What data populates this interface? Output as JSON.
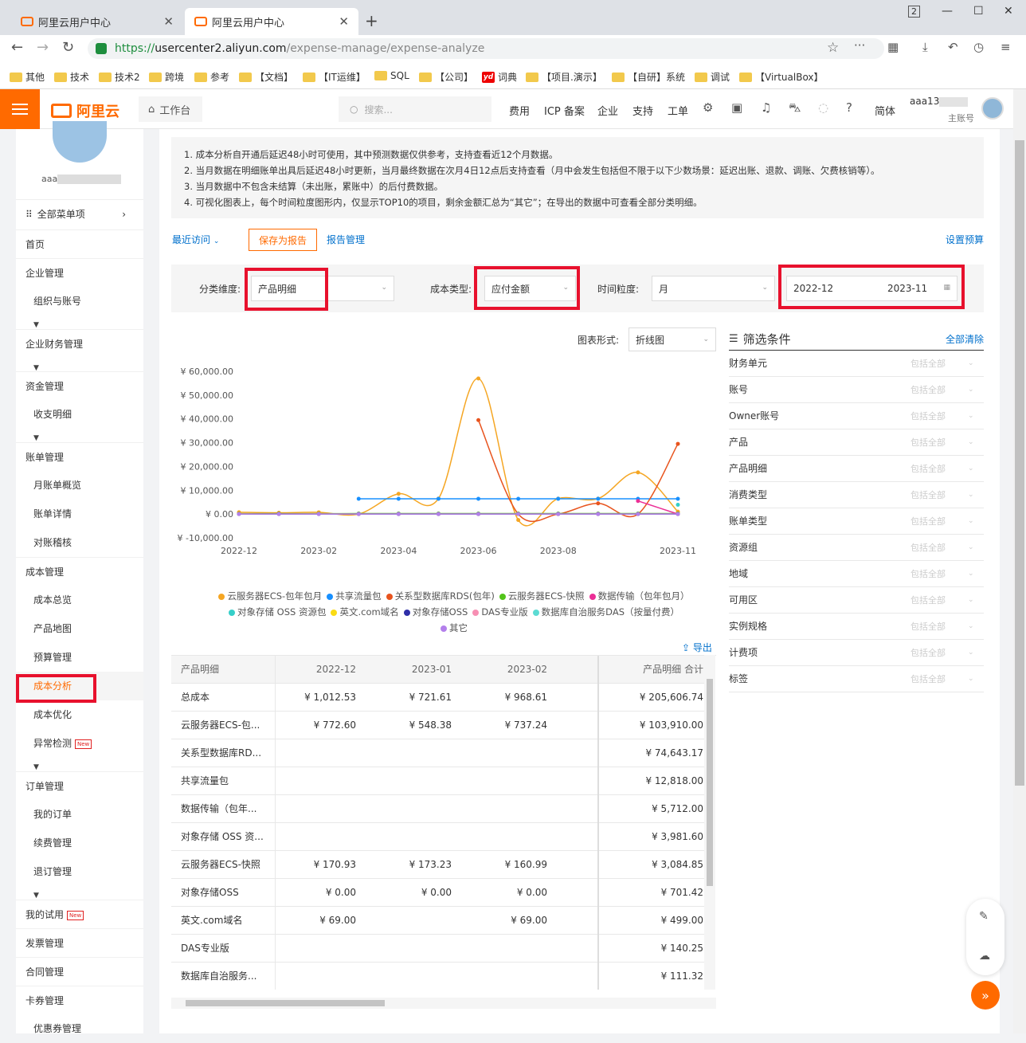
{
  "browser": {
    "tabs": [
      {
        "label": "阿里云用户中心"
      },
      {
        "label": "阿里云用户中心"
      }
    ],
    "tab_count_badge": "2",
    "url": {
      "scheme": "https://",
      "host": "usercenter2.aliyun.com",
      "path": "/expense-manage/expense-analyze"
    },
    "bookmarks": [
      "其他",
      "技术",
      "技术2",
      "跨境",
      "参考",
      "【文档】",
      "【IT运维】",
      "SQL",
      "【公司】",
      "词典",
      "【项目.演示】",
      "【自研】系统",
      "调试",
      "【VirtualBox】"
    ],
    "youdao_label": "yd"
  },
  "header": {
    "logo_text": "阿里云",
    "workbench": "工作台",
    "search_placeholder": "搜索...",
    "nav": [
      "费用",
      "ICP 备案",
      "企业",
      "支持",
      "工单"
    ],
    "lang": "简体",
    "user": "aaa13",
    "user_role": "主账号"
  },
  "sidebar": {
    "username": "aaa",
    "all_menu": "全部菜单项",
    "items": [
      {
        "label": "首页",
        "type": "top"
      },
      {
        "label": "企业管理",
        "type": "top"
      },
      {
        "label": "组织与账号",
        "type": "sub",
        "caret": true
      },
      {
        "label": "企业财务管理",
        "type": "top",
        "caret": true
      },
      {
        "label": "资金管理",
        "type": "top"
      },
      {
        "label": "收支明细",
        "type": "sub",
        "caret": true
      },
      {
        "label": "账单管理",
        "type": "top"
      },
      {
        "label": "月账单概览",
        "type": "sub"
      },
      {
        "label": "账单详情",
        "type": "sub"
      },
      {
        "label": "对账稽核",
        "type": "sub"
      },
      {
        "label": "成本管理",
        "type": "top"
      },
      {
        "label": "成本总览",
        "type": "sub"
      },
      {
        "label": "产品地图",
        "type": "sub"
      },
      {
        "label": "预算管理",
        "type": "sub"
      },
      {
        "label": "成本分析",
        "type": "sub",
        "active": true
      },
      {
        "label": "成本优化",
        "type": "sub"
      },
      {
        "label": "异常检测",
        "type": "sub",
        "badge": "New",
        "caret": true
      },
      {
        "label": "订单管理",
        "type": "top"
      },
      {
        "label": "我的订单",
        "type": "sub"
      },
      {
        "label": "续费管理",
        "type": "sub"
      },
      {
        "label": "退订管理",
        "type": "sub",
        "caret": true
      },
      {
        "label": "我的试用",
        "type": "top",
        "badge": "New"
      },
      {
        "label": "发票管理",
        "type": "top"
      },
      {
        "label": "合同管理",
        "type": "top"
      },
      {
        "label": "卡券管理",
        "type": "top"
      },
      {
        "label": "优惠券管理",
        "type": "sub"
      }
    ]
  },
  "notes": [
    "1. 成本分析自开通后延迟48小时可使用，其中预测数据仅供参考，支持查看近12个月数据。",
    "2. 当月数据在明细账单出具后延迟48小时更新，当月最终数据在次月4日12点后支持查看（月中会发生包括但不限于以下少数场景：延迟出账、退款、调账、欠费核销等）。",
    "3. 当月数据中不包含未结算（未出账，累账中）的后付费数据。",
    "4. 可视化图表上，每个时间粒度图形内，仅显示TOP10的项目，剩余金额汇总为“其它”；在导出的数据中可查看全部分类明细。"
  ],
  "toolbar": {
    "recent": "最近访问",
    "save": "保存为报告",
    "reports": "报告管理",
    "budget": "设置预算"
  },
  "filters_bar": {
    "dimension_label": "分类维度:",
    "dimension_value": "产品明细",
    "cost_type_label": "成本类型:",
    "cost_type_value": "应付金额",
    "granularity_label": "时间粒度:",
    "granularity_value": "月",
    "date_start": "2022-12",
    "date_end": "2023-11"
  },
  "chart_form": {
    "label": "图表形式:",
    "value": "折线图"
  },
  "chart_data": {
    "type": "line",
    "x": [
      "2022-12",
      "2023-01",
      "2023-02",
      "2023-03",
      "2023-04",
      "2023-05",
      "2023-06",
      "2023-07",
      "2023-08",
      "2023-09",
      "2023-10",
      "2023-11"
    ],
    "x_tick_labels": [
      "2022-12",
      "2023-02",
      "2023-04",
      "2023-06",
      "2023-08",
      "2023-11"
    ],
    "y_tick_labels": [
      "¥ 60,000.00",
      "¥ 50,000.00",
      "¥ 40,000.00",
      "¥ 30,000.00",
      "¥ 20,000.00",
      "¥ 10,000.00",
      "¥ 0.00",
      "¥ -10,000.00"
    ],
    "ylim": [
      -10000,
      60000
    ],
    "series": [
      {
        "name": "云服务器ECS-包年包月",
        "color": "#f5a623",
        "values": [
          772.6,
          548.38,
          737.24,
          0,
          8500,
          6500,
          57000,
          -2500,
          6500,
          6500,
          17500,
          1000
        ]
      },
      {
        "name": "共享流量包",
        "color": "#1890ff",
        "values": [
          null,
          null,
          null,
          6400,
          6400,
          6400,
          6400,
          6400,
          6400,
          6400,
          6400,
          6400
        ]
      },
      {
        "name": "关系型数据库RDS(包年)",
        "color": "#e8541e",
        "values": [
          null,
          null,
          null,
          null,
          null,
          null,
          39500,
          0,
          0,
          4500,
          0,
          29500
        ]
      },
      {
        "name": "云服务器ECS-快照",
        "color": "#52c41a",
        "values": [
          170.93,
          173.23,
          160.99,
          200,
          200,
          200,
          200,
          200,
          200,
          200,
          200,
          200
        ]
      },
      {
        "name": "数据传输（包年包月）",
        "color": "#eb2f96",
        "values": [
          null,
          null,
          null,
          null,
          null,
          null,
          null,
          null,
          null,
          null,
          5500,
          0
        ]
      },
      {
        "name": "对象存储 OSS 资源包",
        "color": "#36cfc9",
        "values": [
          null,
          null,
          null,
          null,
          null,
          null,
          null,
          null,
          null,
          null,
          null,
          3900
        ]
      },
      {
        "name": "英文.com域名",
        "color": "#fadb14",
        "values": [
          69,
          0,
          69,
          0,
          0,
          0,
          0,
          0,
          0,
          0,
          0,
          0
        ]
      },
      {
        "name": "对象存储OSS",
        "color": "#2f2fa8",
        "values": [
          0,
          0,
          0,
          0,
          0,
          0,
          0,
          0,
          0,
          0,
          0,
          0
        ]
      },
      {
        "name": "DAS专业版",
        "color": "#f78fb3",
        "values": [
          null,
          null,
          null,
          null,
          null,
          null,
          null,
          null,
          null,
          null,
          null,
          null
        ]
      },
      {
        "name": "数据库自治服务DAS（按量付费）",
        "color": "#5cdbd3",
        "values": [
          null,
          null,
          null,
          null,
          null,
          null,
          null,
          null,
          null,
          null,
          null,
          null
        ]
      },
      {
        "name": "其它",
        "color": "#b37feb",
        "values": [
          0,
          0,
          0,
          0,
          0,
          0,
          0,
          0,
          0,
          0,
          0,
          0
        ]
      }
    ]
  },
  "export": "导出",
  "filter_panel": {
    "title": "筛选条件",
    "clear": "全部清除",
    "include_all": "包括全部",
    "rows": [
      "财务单元",
      "账号",
      "Owner账号",
      "产品",
      "产品明细",
      "消费类型",
      "账单类型",
      "资源组",
      "地域",
      "可用区",
      "实例规格",
      "计费项",
      "标签"
    ]
  },
  "table": {
    "headers": [
      "产品明细",
      "2022-12",
      "2023-01",
      "2023-02",
      "产品明细 合计"
    ],
    "rows": [
      [
        "总成本",
        "¥ 1,012.53",
        "¥ 721.61",
        "¥ 968.61",
        "¥ 205,606.74"
      ],
      [
        "云服务器ECS-包...",
        "¥ 772.60",
        "¥ 548.38",
        "¥ 737.24",
        "¥ 103,910.00"
      ],
      [
        "关系型数据库RD...",
        "",
        "",
        "",
        "¥ 74,643.17"
      ],
      [
        "共享流量包",
        "",
        "",
        "",
        "¥ 12,818.00"
      ],
      [
        "数据传输（包年...",
        "",
        "",
        "",
        "¥ 5,712.00"
      ],
      [
        "对象存储 OSS 资...",
        "",
        "",
        "",
        "¥ 3,981.60"
      ],
      [
        "云服务器ECS-快照",
        "¥ 170.93",
        "¥ 173.23",
        "¥ 160.99",
        "¥ 3,084.85"
      ],
      [
        "对象存储OSS",
        "¥ 0.00",
        "¥ 0.00",
        "¥ 0.00",
        "¥ 701.42"
      ],
      [
        "英文.com域名",
        "¥ 69.00",
        "",
        "¥ 69.00",
        "¥ 499.00"
      ],
      [
        "DAS专业版",
        "",
        "",
        "",
        "¥ 140.25"
      ],
      [
        "数据库自治服务...",
        "",
        "",
        "",
        "¥ 111.32"
      ]
    ]
  }
}
